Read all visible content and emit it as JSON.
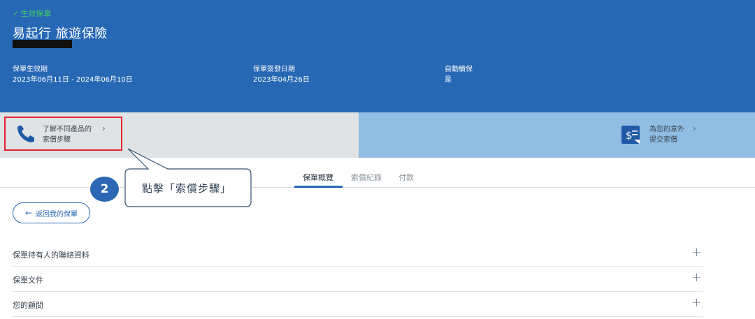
{
  "policy": {
    "status": "生效保單",
    "title": "易起行 旅遊保險",
    "period_label": "保單生效期",
    "period_value": "2023年06月11日 - 2024年06月10日",
    "issue_label": "保單簽發日期",
    "issue_value": "2023年04月26日",
    "renew_label": "自動續保",
    "renew_value": "是"
  },
  "claims": {
    "left_line1": "了解不同產品的",
    "left_line2": "索償步驟",
    "right_line1": "為您的意外",
    "right_line2": "提交索償"
  },
  "callout": {
    "step": "2",
    "text": "點擊「索償步驟」"
  },
  "tabs": [
    {
      "label": "保單概覽",
      "active": true
    },
    {
      "label": "索償紀錄",
      "active": false
    },
    {
      "label": "付款",
      "active": false
    }
  ],
  "back_button": "返回我的保單",
  "accordion": [
    {
      "label": "保單持有人的聯絡資料"
    },
    {
      "label": "保單文件"
    },
    {
      "label": "您的顧問"
    }
  ],
  "colors": {
    "header": "#2768b5",
    "status_green": "#42c86a",
    "highlight_red": "#e4232b",
    "badge_blue": "#2b67b3"
  }
}
